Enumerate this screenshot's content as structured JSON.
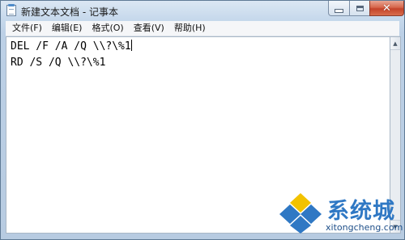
{
  "window": {
    "title": "新建文本文档 - 记事本"
  },
  "menu": {
    "items": [
      {
        "label": "文件(F)"
      },
      {
        "label": "编辑(E)"
      },
      {
        "label": "格式(O)"
      },
      {
        "label": "查看(V)"
      },
      {
        "label": "帮助(H)"
      }
    ]
  },
  "editor": {
    "lines": [
      "DEL /F /A /Q \\\\?\\%1",
      "RD /S /Q \\\\?\\%1"
    ]
  },
  "watermark": {
    "brand": "系统城",
    "url": "xitongcheng.com"
  },
  "colors": {
    "close_button": "#c4432a",
    "watermark_blue": "#2f78c4",
    "watermark_yellow": "#f2c200"
  }
}
